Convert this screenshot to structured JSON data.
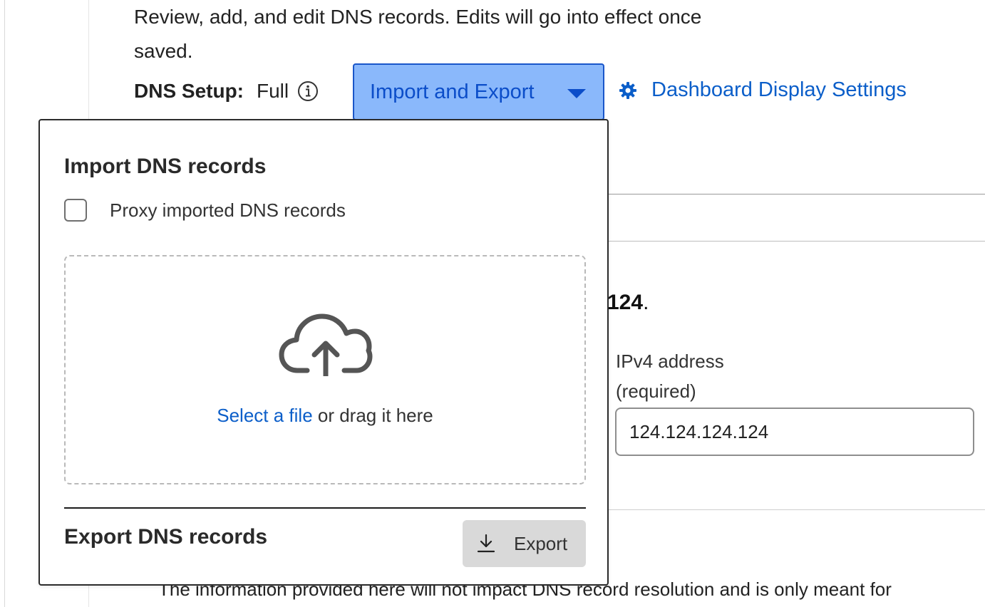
{
  "header": {
    "description": "Review, add, and edit DNS records. Edits will go into effect once saved.",
    "dns_setup_label": "DNS Setup:",
    "dns_setup_value": "Full",
    "import_export_label": "Import and Export",
    "dashboard_settings_label": "Dashboard Display Settings"
  },
  "background": {
    "ip_tail_bold": "124",
    "ip_tail_punct": ".",
    "ipv4_label_line1": "IPv4 address",
    "ipv4_label_line2": "(required)",
    "ipv4_value": "124.124.124.124",
    "bottom_note": "The information provided here will not impact DNS record resolution and is only meant for"
  },
  "popover": {
    "import_title": "Import DNS records",
    "proxy_checkbox_label": "Proxy imported DNS records",
    "proxy_checked": false,
    "dropzone_link": "Select a file",
    "dropzone_text": " or drag it here",
    "export_title": "Export DNS records",
    "export_button_label": "Export"
  },
  "colors": {
    "accent_blue": "#0b5ec9",
    "button_fill": "#8ab8fb",
    "button_border": "#1a56c9"
  }
}
